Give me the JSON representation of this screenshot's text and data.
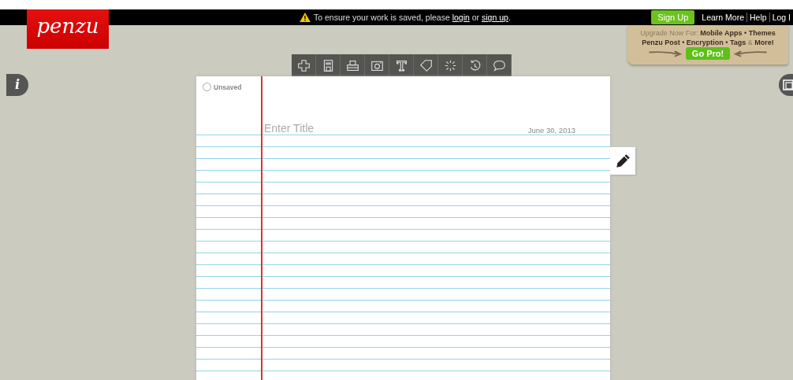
{
  "logo": "penzu",
  "info_button": "i",
  "notice": {
    "before": "To ensure your work is saved, please ",
    "login": "login",
    "middle": " or ",
    "signup": "sign up",
    "after": "."
  },
  "top_links": [
    {
      "label": "Sign Up",
      "kind": "primary"
    },
    {
      "label": "Learn More",
      "kind": "link"
    },
    {
      "label": "Help",
      "kind": "link"
    },
    {
      "label": "Log I",
      "kind": "link"
    }
  ],
  "promo": {
    "line1": "Upgrade Now For: **Mobile Apps • Themes**",
    "line2": "**Penzu Post • Encryption • Tags** & **More!**",
    "button": "Go Pro!"
  },
  "toolbar": [
    {
      "kind": "plus"
    },
    {
      "kind": "save"
    },
    {
      "kind": "print"
    },
    {
      "kind": "photo"
    },
    {
      "kind": "text"
    },
    {
      "kind": "tag"
    },
    {
      "kind": "spinner"
    },
    {
      "kind": "history"
    },
    {
      "kind": "comment"
    }
  ],
  "entry": {
    "status": "Unsaved",
    "title_placeholder": "Enter Title",
    "date": "June 30, 2013"
  }
}
